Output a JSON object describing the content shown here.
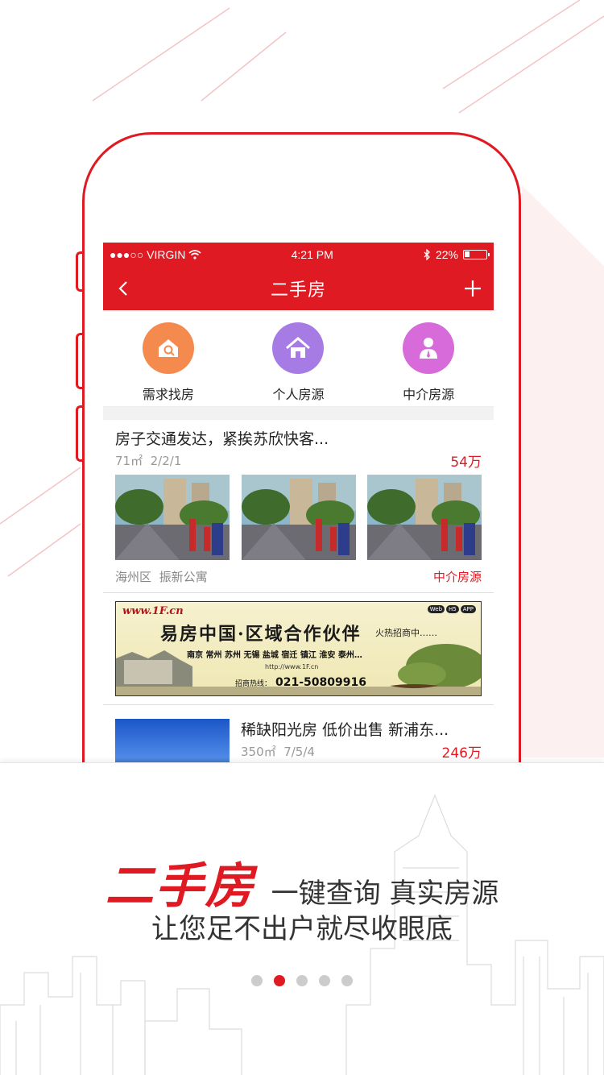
{
  "colors": {
    "accent": "#e01a22",
    "orange": "#f58a4f",
    "purple": "#a77be4",
    "magenta": "#d66bd9"
  },
  "status_bar": {
    "carrier": "●●●○○ VIRGIN",
    "time": "4:21 PM",
    "battery": "22%",
    "battery_level": 0.22
  },
  "nav": {
    "title": "二手房",
    "back_icon": "chevron-left-icon",
    "add_icon": "plus-icon"
  },
  "categories": [
    {
      "label": "需求找房",
      "icon": "house-search-icon"
    },
    {
      "label": "个人房源",
      "icon": "house-icon"
    },
    {
      "label": "中介房源",
      "icon": "agent-icon"
    }
  ],
  "listing1": {
    "title": "房子交通发达，紧挨苏欣快客...",
    "area": "71㎡",
    "layout": "2/2/1",
    "price": "54万",
    "district": "海州区",
    "community": "振新公寓",
    "source": "中介房源"
  },
  "banner": {
    "logo": "www.1F.cn",
    "title": "易房中国·区域合作伙伴",
    "subtitle": "火热招商中……",
    "cities": "南京 常州 苏州 无锡 盐城 宿迁 镇江 淮安 泰州…",
    "url": "http://www.1F.cn",
    "hotline_label": "招商热线：",
    "phone": "021-50809916",
    "tags": [
      "Web",
      "H5",
      "APP"
    ]
  },
  "listing2": {
    "title": "稀缺阳光房 低价出售  新浦东...",
    "area": "350㎡",
    "layout": "7/5/4",
    "price": "246万"
  },
  "promo": {
    "main": "二手房",
    "side": "一键查询 真实房源",
    "line2": "让您足不出户就尽收眼底"
  },
  "pager": {
    "count": 5,
    "active": 2
  }
}
